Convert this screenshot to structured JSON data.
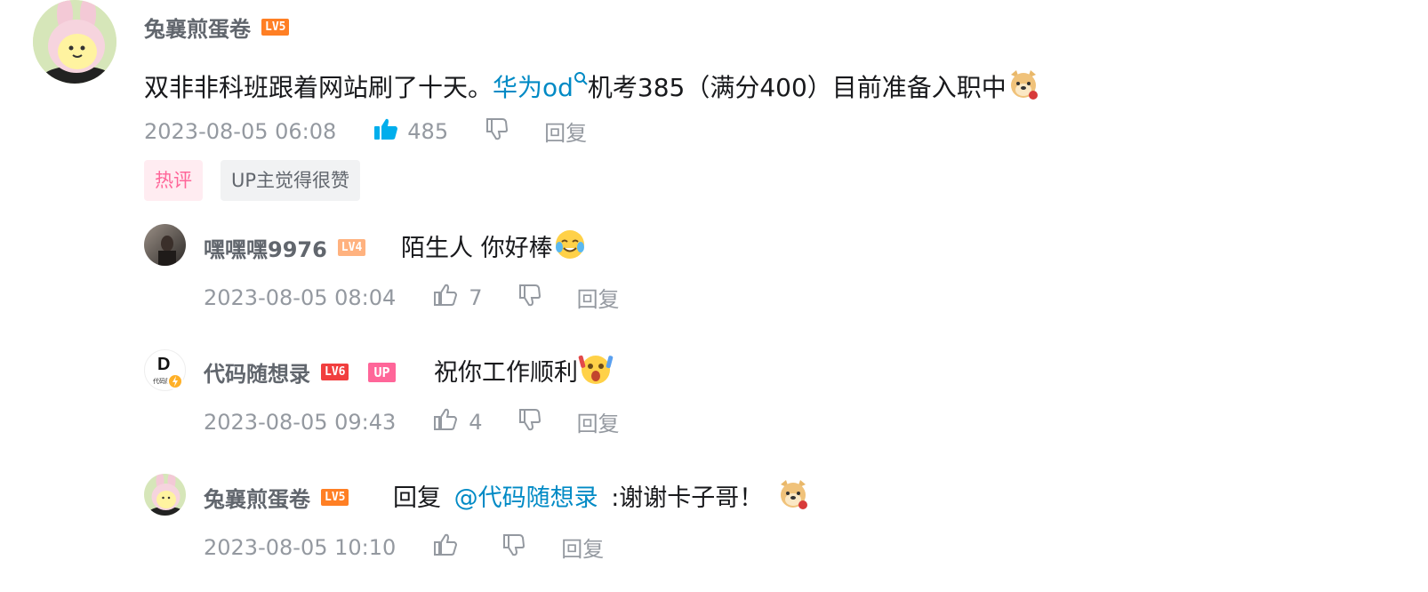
{
  "main_comment": {
    "username": "兔襄煎蛋卷",
    "level": "LV5",
    "text_before": "双非非科班跟着网站刷了十天。",
    "search_link": "华为od",
    "text_after": "机考385（满分400）目前准备入职中",
    "timestamp": "2023-08-05 06:08",
    "like_count": "485",
    "reply_label": "回复",
    "tags": [
      "热评",
      "UP主觉得很赞"
    ]
  },
  "replies": [
    {
      "username": "嘿嘿嘿9976",
      "level": "LV4",
      "text": "陌生人 你好棒",
      "timestamp": "2023-08-05 08:04",
      "like_count": "7",
      "reply_label": "回复"
    },
    {
      "username": "代码随想录",
      "level": "LV6",
      "up_badge": "UP",
      "avatar_letter": "D",
      "avatar_caption": "代码随",
      "text": "祝你工作顺利",
      "timestamp": "2023-08-05 09:43",
      "like_count": "4",
      "reply_label": "回复"
    },
    {
      "username": "兔襄煎蛋卷",
      "level": "LV5",
      "reply_prefix": "回复",
      "mention": "@代码随想录",
      "text": ":谢谢卡子哥！",
      "timestamp": "2023-08-05 10:10",
      "like_count": "",
      "reply_label": "回复"
    }
  ],
  "colors": {
    "link": "#008ac5",
    "like_active": "#00aeec",
    "lv4": "#ffb27f",
    "lv5": "#ff7f24",
    "lv6": "#f13e3e",
    "up_badge": "#ff6699",
    "hot_tag_bg": "#ffecf1",
    "hot_tag_text": "#ff6699",
    "up_tag_bg": "#f1f2f3"
  },
  "icons": [
    "thumbs-up-icon",
    "thumbs-down-icon",
    "search-icon",
    "doge-emoji",
    "laugh-cry-emoji",
    "shock-emoji"
  ]
}
